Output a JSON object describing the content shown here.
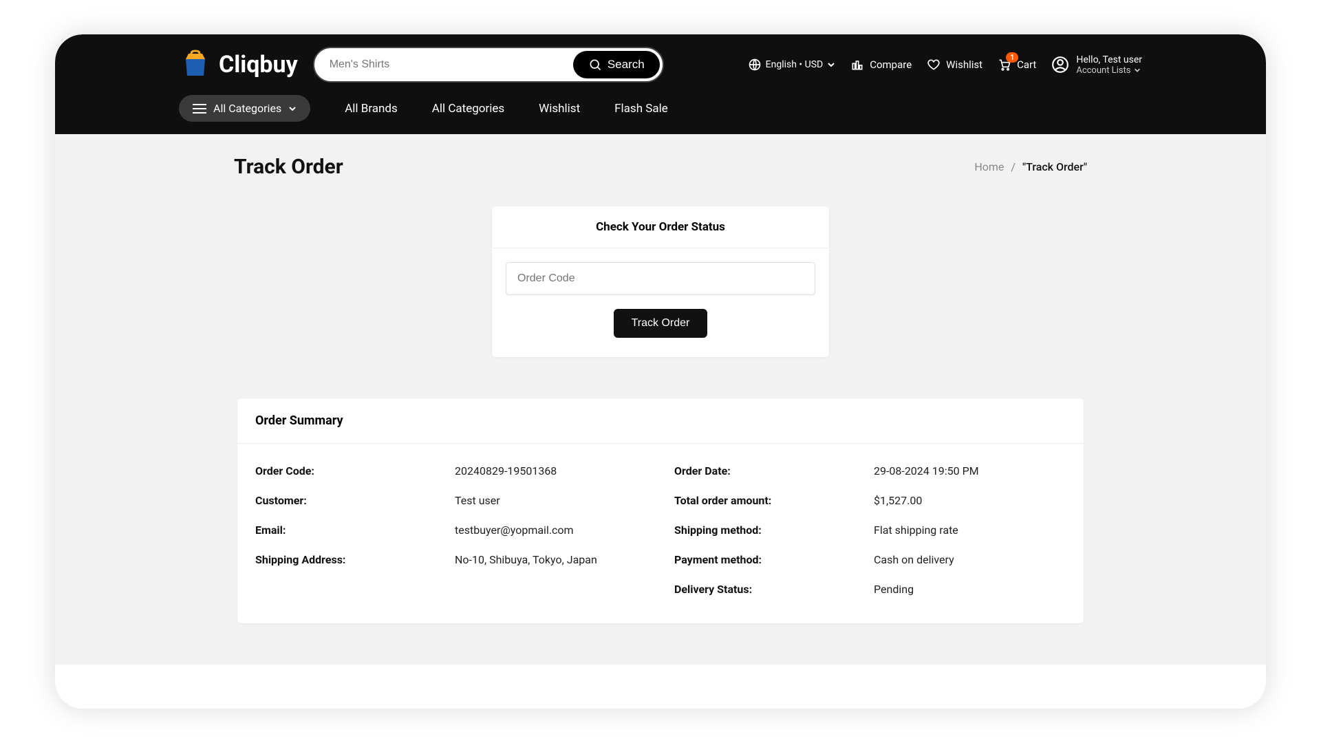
{
  "brand": {
    "name": "Cliqbuy"
  },
  "search": {
    "placeholder": "Men's Shirts",
    "button": "Search"
  },
  "header": {
    "lang": "English • USD",
    "compare": "Compare",
    "wishlist": "Wishlist",
    "cart": "Cart",
    "cart_badge": "1",
    "greeting": "Hello, Test user",
    "account_sub": "Account Lists"
  },
  "nav": {
    "all_categories": "All Categories",
    "links": [
      "All Brands",
      "All Categories",
      "Wishlist",
      "Flash Sale"
    ]
  },
  "page": {
    "title": "Track Order",
    "breadcrumb_home": "Home",
    "breadcrumb_current": "\"Track Order\""
  },
  "check": {
    "title": "Check Your Order Status",
    "placeholder": "Order Code",
    "button": "Track Order"
  },
  "summary": {
    "title": "Order Summary",
    "left": [
      {
        "label": "Order Code:",
        "value": "20240829-19501368"
      },
      {
        "label": "Customer:",
        "value": "Test user"
      },
      {
        "label": "Email:",
        "value": "testbuyer@yopmail.com"
      },
      {
        "label": "Shipping Address:",
        "value": "No-10, Shibuya, Tokyo, Japan"
      }
    ],
    "right": [
      {
        "label": "Order Date:",
        "value": "29-08-2024 19:50 PM"
      },
      {
        "label": "Total order amount:",
        "value": "$1,527.00"
      },
      {
        "label": "Shipping method:",
        "value": "Flat shipping rate"
      },
      {
        "label": "Payment method:",
        "value": "Cash on delivery"
      },
      {
        "label": "Delivery Status:",
        "value": "Pending"
      }
    ]
  }
}
